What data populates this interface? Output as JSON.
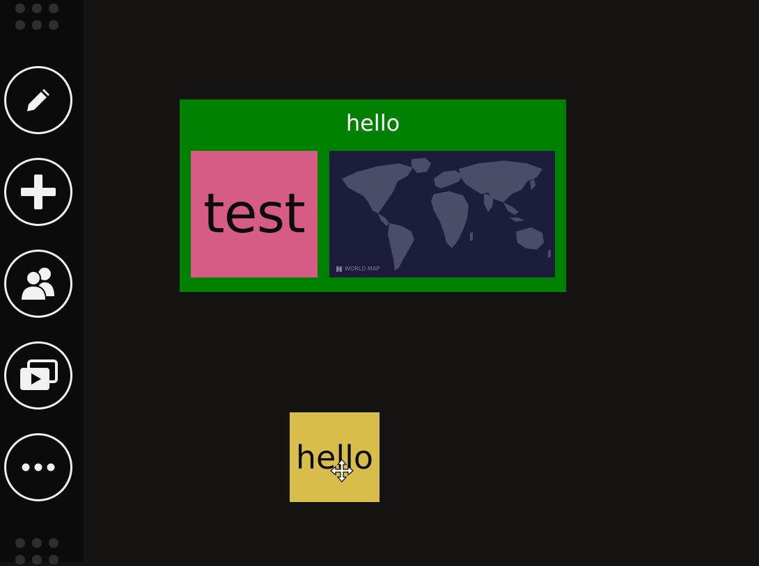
{
  "sidebar": {
    "buttons": [
      {
        "icon": "pencil-icon"
      },
      {
        "icon": "plus-icon"
      },
      {
        "icon": "users-icon"
      },
      {
        "icon": "media-icon"
      },
      {
        "icon": "more-icon"
      }
    ]
  },
  "canvas": {
    "group": {
      "title": "hello",
      "color": "#008000",
      "tiles": [
        {
          "kind": "text",
          "label": "test",
          "color": "#d75c85"
        },
        {
          "kind": "map",
          "caption": "WORLD MAP",
          "color": "#1c1d3a"
        }
      ]
    },
    "standalone_tile": {
      "label": "hello",
      "color": "#d8bd4b"
    },
    "cursor": "move-cursor-icon"
  }
}
